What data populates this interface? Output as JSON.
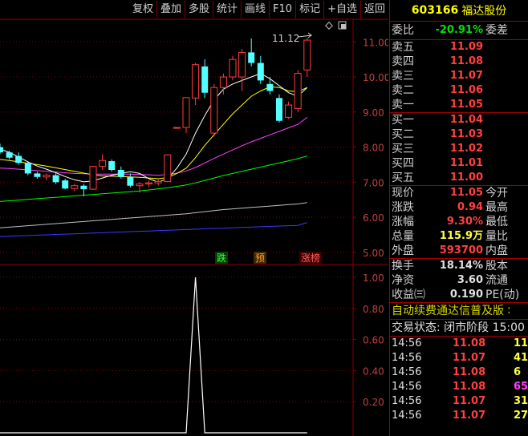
{
  "toolbar": {
    "buttons": [
      "复权",
      "叠加",
      "多股",
      "统计",
      "画线",
      "F10",
      "标记",
      "+自选",
      "返回"
    ]
  },
  "chart": {
    "y_axis_labels": [
      "11.00",
      "10.00",
      "9.00",
      "8.00",
      "7.00",
      "6.00",
      "5.00"
    ],
    "high_label": "11.12",
    "signals": [
      "跌",
      "预",
      "涨榜"
    ],
    "indicator_axis_labels": [
      "1.00",
      "0.80",
      "0.60",
      "0.40",
      "0.20"
    ],
    "colors": {
      "up": "#ff3c3c",
      "down": "#54ffff",
      "grid": "#8b0000",
      "ma5": "#ffffff",
      "ma10": "#ffff00",
      "ma20": "#ff40ff",
      "ma60": "#00ff00",
      "ma120": "#c0c0c0",
      "ma250": "#3a3aff"
    }
  },
  "chart_data": {
    "type": "candlestick",
    "candles": [
      {
        "o": 8.0,
        "h": 8.1,
        "l": 7.8,
        "c": 7.85
      },
      {
        "o": 7.85,
        "h": 7.9,
        "l": 7.65,
        "c": 7.7
      },
      {
        "o": 7.75,
        "h": 7.85,
        "l": 7.5,
        "c": 7.55
      },
      {
        "o": 7.55,
        "h": 7.6,
        "l": 7.2,
        "c": 7.25
      },
      {
        "o": 7.25,
        "h": 7.3,
        "l": 7.1,
        "c": 7.15
      },
      {
        "o": 7.15,
        "h": 7.25,
        "l": 7.05,
        "c": 7.2
      },
      {
        "o": 7.2,
        "h": 7.25,
        "l": 6.95,
        "c": 7.0
      },
      {
        "o": 7.05,
        "h": 7.1,
        "l": 6.8,
        "c": 6.82
      },
      {
        "o": 6.82,
        "h": 6.95,
        "l": 6.75,
        "c": 6.9
      },
      {
        "o": 6.9,
        "h": 6.95,
        "l": 6.6,
        "c": 6.8
      },
      {
        "o": 6.8,
        "h": 7.45,
        "l": 6.78,
        "c": 7.45
      },
      {
        "o": 7.45,
        "h": 7.8,
        "l": 7.35,
        "c": 7.62
      },
      {
        "o": 7.6,
        "h": 7.65,
        "l": 7.3,
        "c": 7.35
      },
      {
        "o": 7.35,
        "h": 7.45,
        "l": 7.1,
        "c": 7.15
      },
      {
        "o": 7.15,
        "h": 7.25,
        "l": 6.85,
        "c": 6.9
      },
      {
        "o": 6.9,
        "h": 7.0,
        "l": 6.7,
        "c": 6.95
      },
      {
        "o": 6.95,
        "h": 7.05,
        "l": 6.85,
        "c": 6.98
      },
      {
        "o": 6.98,
        "h": 7.1,
        "l": 6.9,
        "c": 7.02
      },
      {
        "o": 7.02,
        "h": 7.8,
        "l": 7.0,
        "c": 7.78
      },
      {
        "o": 8.56,
        "h": 8.56,
        "l": 8.56,
        "c": 8.56
      },
      {
        "o": 8.56,
        "h": 9.41,
        "l": 8.4,
        "c": 9.41
      },
      {
        "o": 9.4,
        "h": 10.4,
        "l": 9.2,
        "c": 10.35
      },
      {
        "o": 10.3,
        "h": 10.5,
        "l": 9.4,
        "c": 9.55
      },
      {
        "o": 8.4,
        "h": 9.8,
        "l": 8.3,
        "c": 9.7
      },
      {
        "o": 9.7,
        "h": 10.1,
        "l": 9.5,
        "c": 10.0
      },
      {
        "o": 10.0,
        "h": 10.6,
        "l": 9.9,
        "c": 10.5
      },
      {
        "o": 10.0,
        "h": 10.8,
        "l": 9.6,
        "c": 10.7
      },
      {
        "o": 10.7,
        "h": 11.1,
        "l": 10.3,
        "c": 10.4
      },
      {
        "o": 10.4,
        "h": 10.6,
        "l": 9.8,
        "c": 9.9
      },
      {
        "o": 9.8,
        "h": 10.0,
        "l": 9.5,
        "c": 9.6
      },
      {
        "o": 9.4,
        "h": 9.5,
        "l": 8.7,
        "c": 8.75
      },
      {
        "o": 8.85,
        "h": 9.3,
        "l": 8.8,
        "c": 9.2
      },
      {
        "o": 9.1,
        "h": 10.2,
        "l": 9.0,
        "c": 10.1
      },
      {
        "o": 10.2,
        "h": 11.12,
        "l": 10.0,
        "c": 11.05
      }
    ],
    "ma5": [
      7.95,
      7.85,
      7.72,
      7.58,
      7.46,
      7.37,
      7.27,
      7.16,
      7.07,
      7.01,
      7.04,
      7.12,
      7.2,
      7.25,
      7.3,
      7.25,
      7.1,
      7.0,
      7.1,
      7.4,
      7.8,
      8.4,
      8.9,
      9.35,
      9.65,
      9.8,
      9.9,
      10.0,
      10.1,
      9.95,
      9.75,
      9.55,
      9.45,
      9.7
    ],
    "ma10": [
      7.65,
      7.62,
      7.58,
      7.54,
      7.5,
      7.46,
      7.41,
      7.36,
      7.31,
      7.26,
      7.21,
      7.18,
      7.17,
      7.16,
      7.15,
      7.14,
      7.12,
      7.1,
      7.13,
      7.25,
      7.4,
      7.7,
      8.05,
      8.35,
      8.65,
      8.95,
      9.2,
      9.45,
      9.6,
      9.72,
      9.7,
      9.6,
      9.58,
      9.7
    ],
    "ma20": [
      7.4,
      7.39,
      7.37,
      7.35,
      7.33,
      7.31,
      7.29,
      7.27,
      7.25,
      7.24,
      7.23,
      7.23,
      7.23,
      7.23,
      7.23,
      7.22,
      7.21,
      7.2,
      7.22,
      7.26,
      7.32,
      7.42,
      7.55,
      7.68,
      7.8,
      7.92,
      8.04,
      8.15,
      8.25,
      8.35,
      8.45,
      8.55,
      8.65,
      8.85
    ],
    "ma60": [
      6.45,
      6.47,
      6.49,
      6.51,
      6.53,
      6.55,
      6.57,
      6.59,
      6.61,
      6.63,
      6.65,
      6.67,
      6.69,
      6.71,
      6.73,
      6.75,
      6.78,
      6.81,
      6.84,
      6.88,
      6.92,
      6.98,
      7.05,
      7.12,
      7.19,
      7.25,
      7.31,
      7.37,
      7.43,
      7.49,
      7.55,
      7.61,
      7.67,
      7.75
    ],
    "ma120": [
      5.7,
      5.72,
      5.74,
      5.76,
      5.78,
      5.8,
      5.82,
      5.84,
      5.86,
      5.88,
      5.9,
      5.92,
      5.94,
      5.96,
      5.98,
      6.0,
      6.02,
      6.04,
      6.06,
      6.08,
      6.1,
      6.13,
      6.16,
      6.19,
      6.22,
      6.24,
      6.26,
      6.28,
      6.3,
      6.32,
      6.34,
      6.36,
      6.38,
      6.42
    ],
    "ma250": [
      5.45,
      5.46,
      5.47,
      5.48,
      5.49,
      5.5,
      5.51,
      5.52,
      5.53,
      5.54,
      5.55,
      5.56,
      5.57,
      5.58,
      5.59,
      5.6,
      5.61,
      5.62,
      5.63,
      5.64,
      5.65,
      5.66,
      5.67,
      5.68,
      5.69,
      5.7,
      5.71,
      5.72,
      5.73,
      5.74,
      5.75,
      5.76,
      5.77,
      5.85
    ],
    "indicator_values": [
      0,
      0,
      0,
      0,
      0,
      0,
      0,
      0,
      0,
      0,
      0,
      0,
      0,
      0,
      0,
      0,
      0,
      0,
      0,
      0,
      0,
      1,
      0,
      0,
      0,
      0,
      0,
      0,
      0,
      0,
      0,
      0,
      0,
      0
    ],
    "ylim": [
      4.7,
      11.6
    ],
    "indicator_ylim": [
      0,
      1
    ]
  },
  "quote": {
    "code": "603166",
    "name": "福达股份",
    "weibi_label": "委比",
    "weibi_value": "-20.91%",
    "weicha_label": "委差",
    "sell": [
      {
        "label": "卖五",
        "price": "11.09"
      },
      {
        "label": "卖四",
        "price": "11.08"
      },
      {
        "label": "卖三",
        "price": "11.07"
      },
      {
        "label": "卖二",
        "price": "11.06"
      },
      {
        "label": "卖一",
        "price": "11.05"
      }
    ],
    "buy": [
      {
        "label": "买一",
        "price": "11.04"
      },
      {
        "label": "买二",
        "price": "11.03"
      },
      {
        "label": "买三",
        "price": "11.02"
      },
      {
        "label": "买四",
        "price": "11.01"
      },
      {
        "label": "买五",
        "price": "11.00"
      }
    ],
    "stats": [
      {
        "label": "现价",
        "value": "11.05",
        "label2": "今开"
      },
      {
        "label": "涨跌",
        "value": "0.94",
        "label2": "最高"
      },
      {
        "label": "涨幅",
        "value": "9.30%",
        "label2": "最低"
      },
      {
        "label": "总量",
        "value": "115.9万",
        "label2": "量比"
      },
      {
        "label": "外盘",
        "value": "593700",
        "label2": "内盘"
      }
    ],
    "stats2": [
      {
        "label": "换手",
        "value": "18.14%",
        "label2": "股本"
      },
      {
        "label": "净资",
        "value": "3.60",
        "label2": "流通"
      },
      {
        "label": "收益㈢",
        "value": "0.190",
        "label2": "PE(动)"
      }
    ],
    "promo": "自动续费通达信普及版 ∶",
    "trade_status": "交易状态: 闭市阶段 15:00",
    "ticks": [
      {
        "time": "14:56",
        "price": "11.08",
        "vol": "11",
        "vol_color": "#ffff40"
      },
      {
        "time": "14:56",
        "price": "11.07",
        "vol": "41",
        "vol_color": "#ffff40"
      },
      {
        "time": "14:56",
        "price": "11.08",
        "vol": "6",
        "vol_color": "#ffff40"
      },
      {
        "time": "14:56",
        "price": "11.08",
        "vol": "65",
        "vol_color": "#ff40ff"
      },
      {
        "time": "14:56",
        "price": "11.07",
        "vol": "31",
        "vol_color": "#ffff40"
      },
      {
        "time": "14:56",
        "price": "11.07",
        "vol": "27",
        "vol_color": "#ffff40"
      }
    ]
  }
}
